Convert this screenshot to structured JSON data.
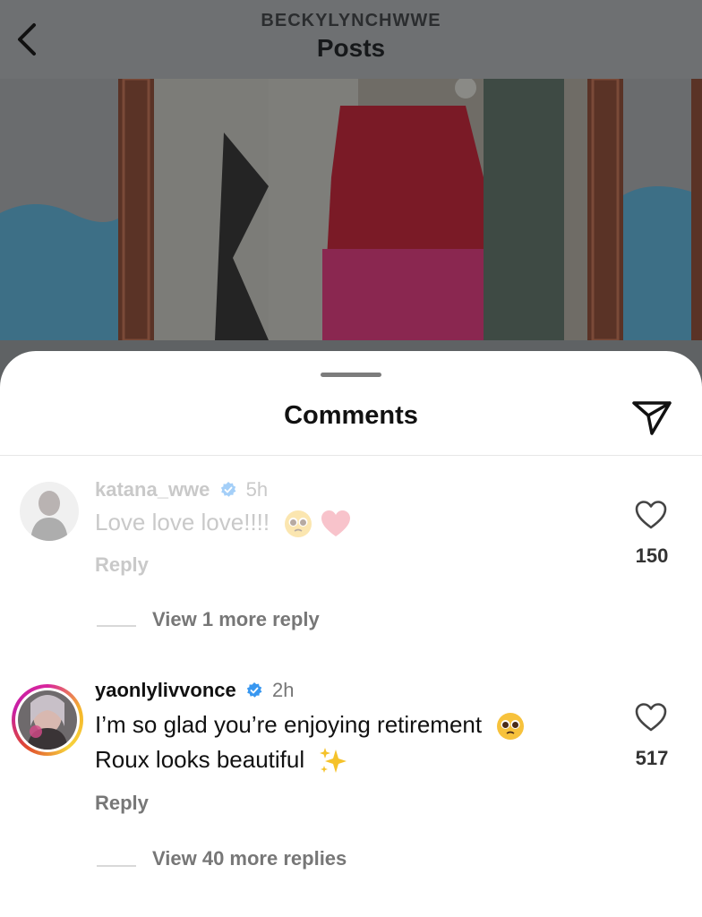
{
  "header": {
    "account": "BECKYLYNCHWWE",
    "title": "Posts"
  },
  "sheet": {
    "title": "Comments"
  },
  "comments": [
    {
      "username": "katana_wwe",
      "time": "5h",
      "text": "Love love love!!!!",
      "emojis": [
        "pleading-face-emoji",
        "heart-emoji"
      ],
      "reply_label": "Reply",
      "likes": "150",
      "more_replies": "View 1 more reply",
      "verified": true,
      "faded": true
    },
    {
      "username": "yaonlylivvonce",
      "time": "2h",
      "text_line1": "I’m so glad you’re enjoying retirement",
      "text_line2": "Roux looks beautiful",
      "emojis": [
        "pleading-face-emoji",
        "sparkles-emoji"
      ],
      "reply_label": "Reply",
      "likes": "517",
      "more_replies": "View 40 more replies",
      "verified": true,
      "has_story_ring": true
    }
  ],
  "colors": {
    "verified_blue": "#3897f0",
    "story_ring": [
      "#d8259d",
      "#f5b62a"
    ],
    "dim_overlay": "#5f6264"
  }
}
